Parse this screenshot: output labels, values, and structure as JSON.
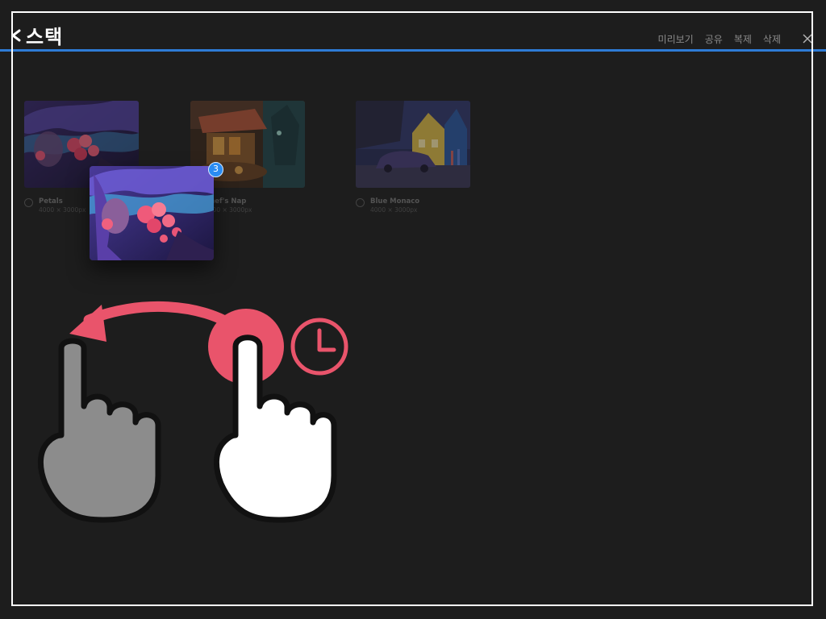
{
  "header": {
    "back_label": "스택",
    "actions": [
      "미리보기",
      "공유",
      "복제",
      "삭제"
    ]
  },
  "artworks": [
    {
      "title": "Petals",
      "size": "4000 × 3000px"
    },
    {
      "title": "Chef's Nap",
      "size": "4000 × 3000px"
    },
    {
      "title": "Blue Monaco",
      "size": "4000 × 3000px"
    }
  ],
  "selection": {
    "count": "3"
  },
  "icons": [
    "back-chevron-icon",
    "close-icon",
    "hand-pointer-icon",
    "clock-icon",
    "swipe-arrow-icon"
  ],
  "colors": {
    "accent": "#2e7bd6",
    "gesture": "#e9546b",
    "badge": "#2a8cf2"
  }
}
